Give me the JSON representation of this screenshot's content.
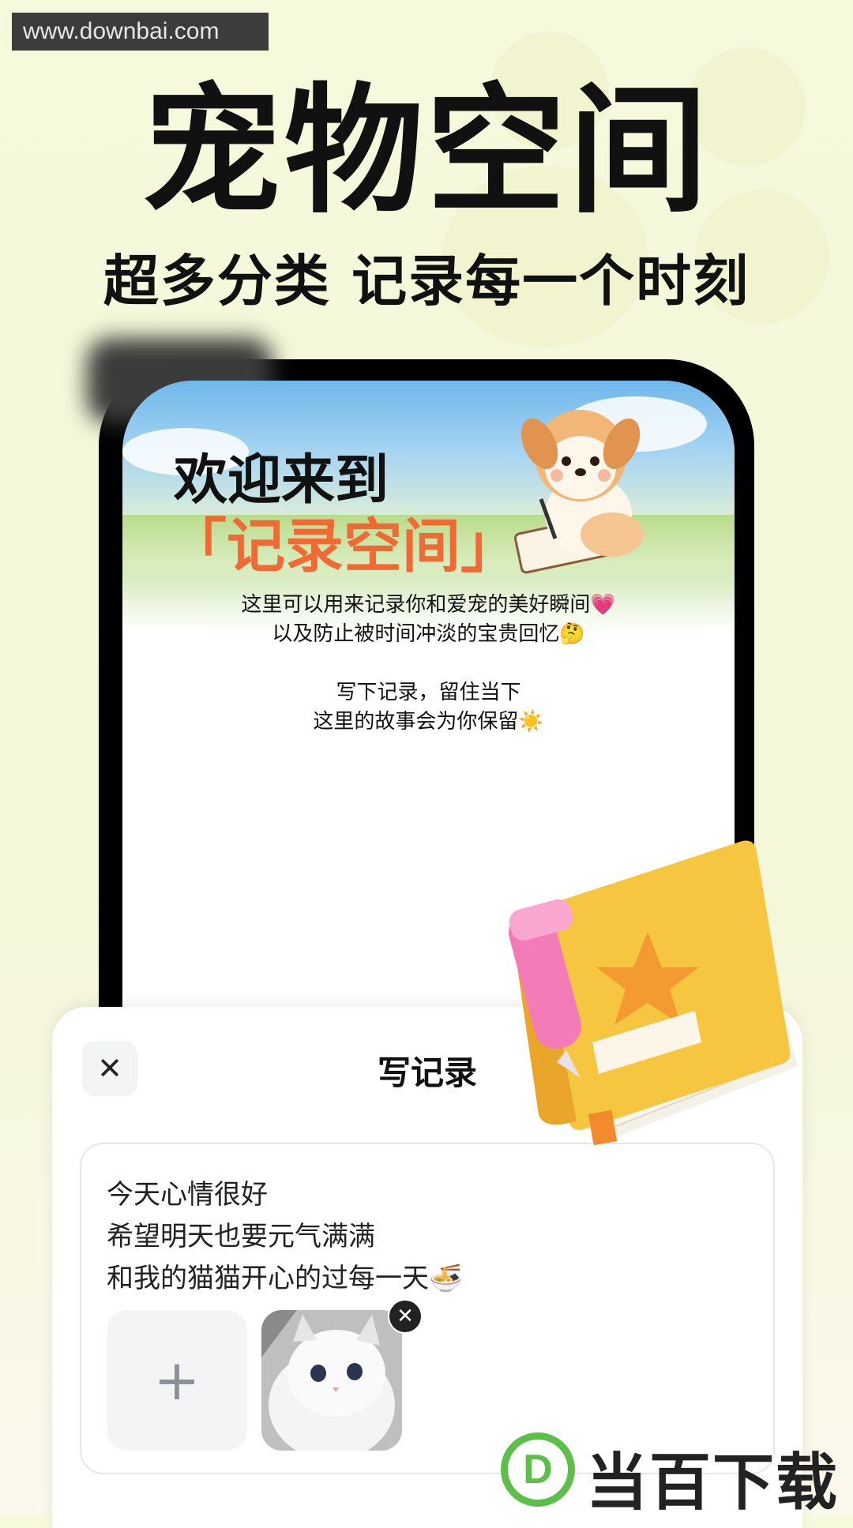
{
  "watermark": "www.downbai.com",
  "hero": {
    "title": "宠物空间",
    "subtitle": "超多分类 记录每一个时刻"
  },
  "screen": {
    "banner_line1": "欢迎来到",
    "banner_line2": "「记录空间」",
    "intro_lines": [
      "这里可以用来记录你和爱宠的美好瞬间💗",
      "以及防止被时间冲淡的宝贵回忆🤔",
      "写下记录，留住当下",
      "这里的故事会为你保留☀️"
    ]
  },
  "sheet": {
    "close_icon": "✕",
    "title": "写记录",
    "note_lines": [
      "今天心情很好",
      "希望明天也要元气满满",
      "和我的猫猫开心的过每一天🍜"
    ],
    "add_icon": "+",
    "remove_icon": "✕"
  },
  "brand": {
    "badge_letter": "D",
    "name": "当百下载"
  },
  "colors": {
    "background": "#f6f8dc",
    "accent_orange": "#f06a35",
    "brand_green": "#5bbf4a"
  }
}
